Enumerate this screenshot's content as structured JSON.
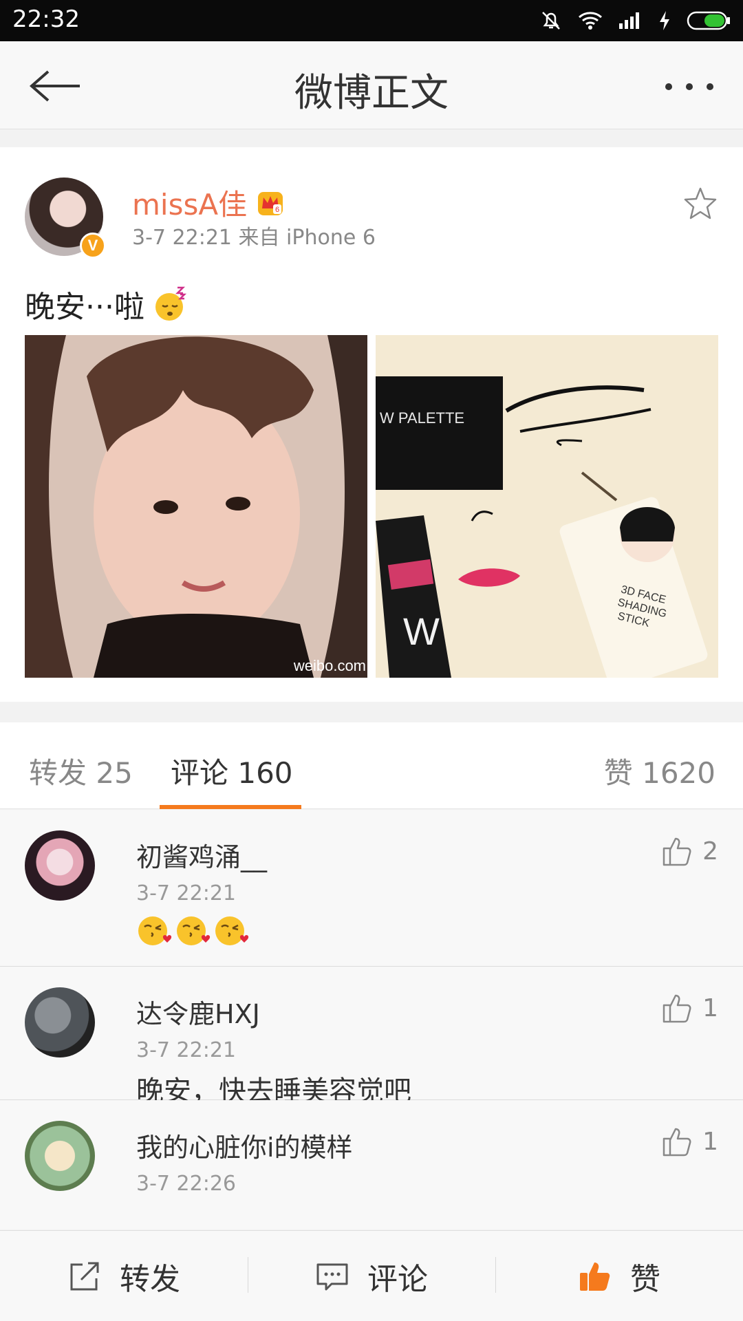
{
  "status_bar": {
    "time": "22:32"
  },
  "nav": {
    "title": "微博正文",
    "back_icon": "arrow-left-icon",
    "more_icon": "more-dots-icon"
  },
  "post": {
    "author": "missA佳",
    "meta": "3-7 22:21  来自 iPhone 6",
    "text": "晚安···啦",
    "verified_badge": "V",
    "image_watermark": "weibo.com",
    "accent_color": "#eb7350"
  },
  "tabs": {
    "repost": "转发 25",
    "comment": "评论 160",
    "like": "赞 1620",
    "active_color": "#f57a1d"
  },
  "comments": [
    {
      "name": "初酱鸡涌__",
      "time": "3-7 22:21",
      "text": "",
      "likes": "2"
    },
    {
      "name": "达令鹿HXJ",
      "time": "3-7 22:21",
      "text": "晚安，快去睡美容觉吧",
      "likes": "1"
    },
    {
      "name": "我的心脏你i的模样",
      "time": "3-7 22:26",
      "text": "",
      "likes": "1"
    }
  ],
  "bottom_bar": {
    "repost": "转发",
    "comment": "评论",
    "like": "赞"
  }
}
